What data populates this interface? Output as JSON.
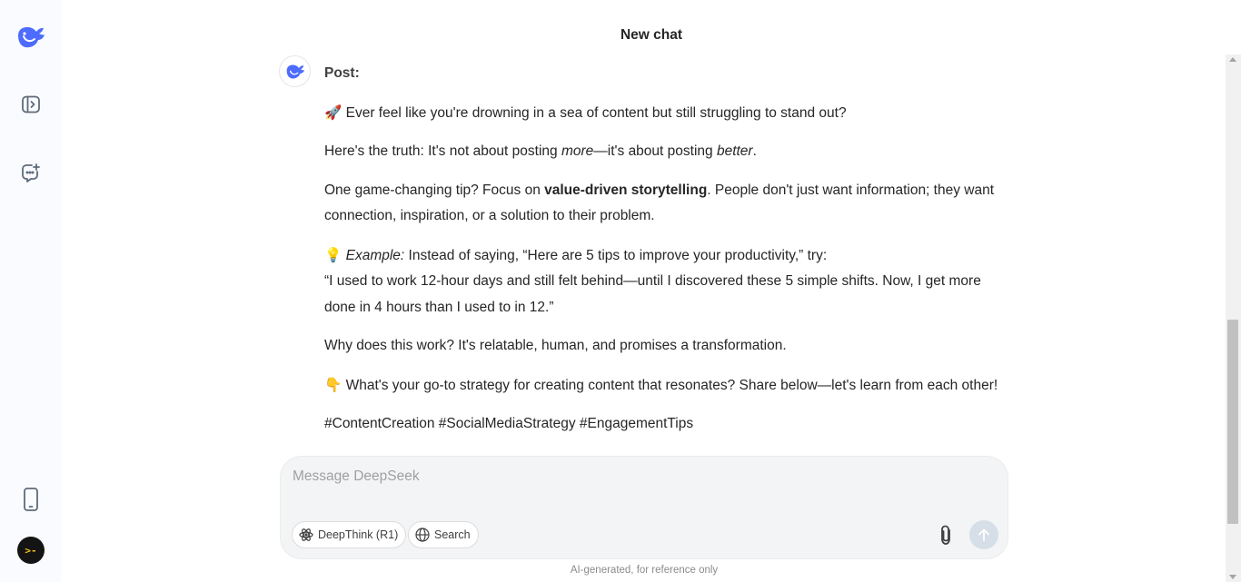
{
  "header": {
    "title": "New chat"
  },
  "sidebar": {
    "logo_icon": "deepseek-whale-logo",
    "items": [
      {
        "name": "toggle-sidebar",
        "icon": "sidebar-toggle-icon"
      },
      {
        "name": "new-chat",
        "icon": "new-chat-icon"
      },
      {
        "name": "get-app",
        "icon": "mobile-phone-icon"
      }
    ],
    "avatar_glyph": ">-",
    "avatar_color": "#141414"
  },
  "message": {
    "heading": "Post:",
    "p1_emoji": "🚀",
    "p1_text": " Ever feel like you're drowning in a sea of content but still struggling to stand out?",
    "p2_a": "Here's the truth: It's not about posting ",
    "p2_em1": "more",
    "p2_b": "—it's about posting ",
    "p2_em2": "better",
    "p2_c": ".",
    "p3_a": "One game-changing tip? Focus on ",
    "p3_strong": "value-driven storytelling",
    "p3_b": ". People don't just want information; they want connection, inspiration, or a solution to their problem.",
    "p4_emoji": "💡",
    "p4_em": "Example:",
    "p4_a": " Instead of saying, “Here are 5 tips to improve your productivity,” try:",
    "p4_b": "“I used to work 12-hour days and still felt behind—until I discovered these 5 simple shifts. Now, I get more done in 4 hours than I used to in 12.”",
    "p5": "Why does this work? It's relatable, human, and promises a transformation.",
    "p6_emoji": "👇",
    "p6_text": " What's your go-to strategy for creating content that resonates? Share below—let's learn from each other!",
    "p7": "#ContentCreation #SocialMediaStrategy #EngagementTips"
  },
  "composer": {
    "placeholder": "Message DeepSeek",
    "deepthink_label": "DeepThink (R1)",
    "search_label": "Search",
    "send_color": "#d6dee8"
  },
  "footer": {
    "disclaimer": "AI-generated, for reference only"
  },
  "colors": {
    "accent": "#4d6bfe",
    "sidebar_bg": "#f9fbff"
  }
}
